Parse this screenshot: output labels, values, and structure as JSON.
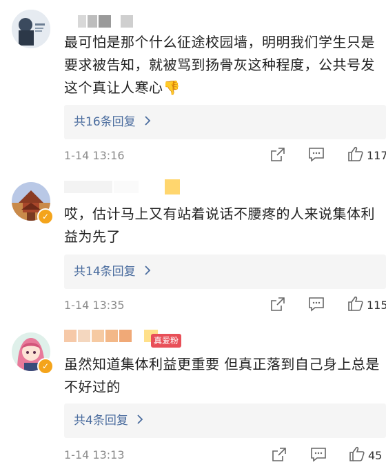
{
  "comments": [
    {
      "text": "最可怕是那个什么征途校园墙，明明我们学生只是要求被告知，就被骂到扬骨灰这种程度，公共号发这个真让人寒心👎",
      "replies": "共16条回复",
      "time": "1-14 13:16",
      "likes": "117",
      "verified": false,
      "fan_badge": ""
    },
    {
      "text": "哎，估计马上又有站着说话不腰疼的人来说集体利益为先了",
      "replies": "共14条回复",
      "time": "1-14 13:35",
      "likes": "115",
      "verified": true,
      "fan_badge": ""
    },
    {
      "text": "虽然知道集体利益更重要 但真正落到自己身上总是不好过的",
      "replies": "共4条回复",
      "time": "1-14 13:13",
      "likes": "45",
      "verified": true,
      "fan_badge": "真爱粉"
    }
  ],
  "icons": {
    "share": "share-icon",
    "comment": "comment-icon",
    "like": "thumbs-up-icon",
    "chevron": "chevron-right-icon",
    "verified": "verified-badge-icon"
  },
  "colors": {
    "link": "#4a6c9e",
    "text": "#222222",
    "meta": "#8a8a8a",
    "reply_bg": "#f5f5f5",
    "verified": "#f4a41b",
    "fan_badge": "#e84f58"
  }
}
